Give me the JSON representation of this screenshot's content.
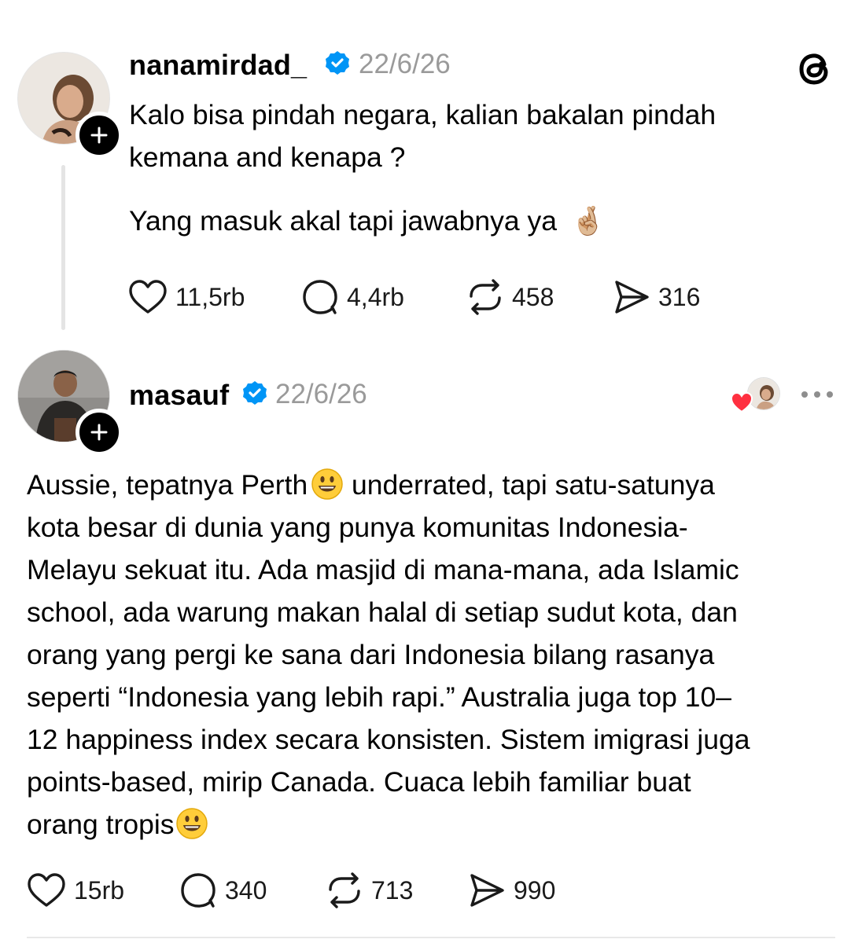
{
  "app": {
    "logo_icon": "threads-logo-icon"
  },
  "posts": [
    {
      "username": "nanamirdad_",
      "verified_icon": "verified-badge-icon",
      "date": "22/6/26",
      "text_lines": [
        "Kalo bisa pindah negara, kalian bakalan pindah",
        "kemana and kenapa ?"
      ],
      "text_line_2": "Yang masuk akal tapi jawabnya ya",
      "emoji": "🤞🏼",
      "stats": {
        "likes": "11,5rb",
        "replies": "4,4rb",
        "reposts": "458",
        "shares": "316"
      }
    },
    {
      "username": "masauf",
      "verified_icon": "verified-badge-icon",
      "date": "22/6/26",
      "liked_by_author_icon": "heart-avatar-icon",
      "more_icon": "more-options-icon",
      "text_lines": [
        "Aussie, tepatnya Perth",
        " underrated, tapi satu-satunya",
        "kota besar di dunia yang punya komunitas Indonesia-",
        "Melayu sekuat itu. Ada masjid di mana-mana, ada Islamic",
        "school, ada warung makan halal di setiap sudut kota, dan",
        "orang yang pergi ke sana dari Indonesia bilang rasanya",
        "seperti “Indonesia yang lebih rapi.” Australia juga top 10–",
        "12 happiness index secara konsisten. Sistem imigrasi juga",
        "points-based, mirip Canada. Cuaca lebih familiar buat",
        "orang tropis"
      ],
      "stats": {
        "likes": "15rb",
        "replies": "340",
        "reposts": "713",
        "shares": "990"
      }
    }
  ],
  "colors": {
    "verified": "#0095f6",
    "heart": "#ff3040",
    "muted": "#9a9a9a"
  }
}
